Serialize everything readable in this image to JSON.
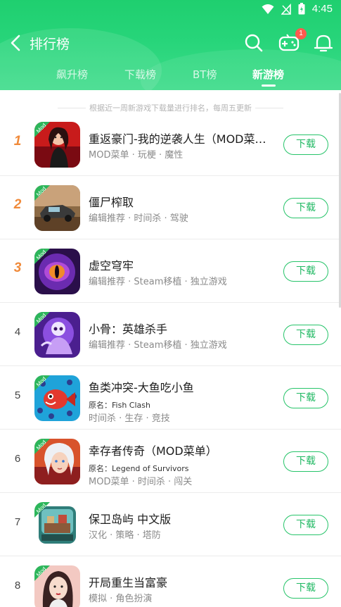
{
  "status": {
    "time": "4:45"
  },
  "header": {
    "title": "排行榜",
    "badge_count": "1",
    "tabs": [
      {
        "label": "飙升榜",
        "active": false
      },
      {
        "label": "下载榜",
        "active": false
      },
      {
        "label": "BT榜",
        "active": false
      },
      {
        "label": "新游榜",
        "active": true
      }
    ]
  },
  "notice": "根据近一周新游戏下载量进行排名，每周五更新",
  "mod_label": "Mod",
  "download_label": "下载",
  "apps": [
    {
      "rank": "1",
      "name": "重返豪门-我的逆袭人生（MOD菜单...",
      "tags": "MOD菜单 · 玩梗 · 魔性"
    },
    {
      "rank": "2",
      "name": "僵尸榨取",
      "tags": "编辑推荐 · 时间杀 · 驾驶"
    },
    {
      "rank": "3",
      "name": "虚空穹牢",
      "tags": "编辑推荐 · Steam移植 · 独立游戏"
    },
    {
      "rank": "4",
      "name": "小骨：英雄杀手",
      "tags": "编辑推荐 · Steam移植 · 独立游戏"
    },
    {
      "rank": "5",
      "name": "鱼类冲突-大鱼吃小鱼",
      "original": "原名：Fish Clash",
      "tags": "时间杀 · 生存 · 竞技"
    },
    {
      "rank": "6",
      "name": "幸存者传奇（MOD菜单）",
      "original": "原名：Legend of Survivors",
      "tags": "MOD菜单 · 时间杀 · 闯关"
    },
    {
      "rank": "7",
      "name": "保卫岛屿 中文版",
      "tags": "汉化 · 策略 · 塔防"
    },
    {
      "rank": "8",
      "name": "开局重生当富豪",
      "tags": "模拟 · 角色扮演"
    }
  ],
  "colors": {
    "accent": "#1fcf6f",
    "rank_top": "#f08a3a",
    "badge": "#ff5a4e"
  }
}
